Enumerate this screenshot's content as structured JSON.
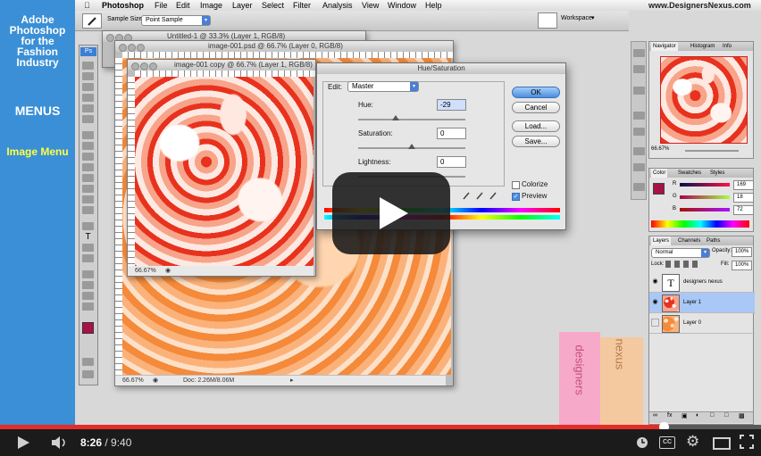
{
  "sidebar": {
    "title": "Adobe Photoshop for the Fashion Industry",
    "section": "MENUS",
    "topic": "Image Menu"
  },
  "menubar": {
    "app": "Photoshop",
    "items": [
      "File",
      "Edit",
      "Image",
      "Layer",
      "Select",
      "Filter",
      "Analysis",
      "View",
      "Window",
      "Help"
    ],
    "brand": "www.DesignersNexus.com"
  },
  "options": {
    "sample_size_label": "Sample Size:",
    "sample_size_value": "Point Sample",
    "workspace": "Workspace"
  },
  "windows": {
    "untitled": {
      "title": "Untitled-1 @ 33.3% (Layer 1, RGB/8)"
    },
    "image001": {
      "title": "image-001.psd @ 66.7% (Layer 0, RGB/8)",
      "zoom": "66.67%",
      "doc": "Doc: 2.26M/8.06M"
    },
    "copy": {
      "title": "image-001 copy @ 66.7% (Layer 1, RGB/8)",
      "zoom": "66.67%"
    }
  },
  "hue_saturation": {
    "title": "Hue/Saturation",
    "edit_label": "Edit:",
    "edit_value": "Master",
    "hue_label": "Hue:",
    "hue_value": "-29",
    "saturation_label": "Saturation:",
    "saturation_value": "0",
    "lightness_label": "Lightness:",
    "lightness_value": "0",
    "buttons": {
      "ok": "OK",
      "cancel": "Cancel",
      "load": "Load...",
      "save": "Save..."
    },
    "colorize_label": "Colorize",
    "colorize_checked": false,
    "preview_label": "Preview",
    "preview_checked": true
  },
  "navigator": {
    "tabs": [
      "Navigator",
      "Histogram",
      "Info"
    ],
    "zoom": "66.67%"
  },
  "color_panel": {
    "tabs": [
      "Color",
      "Swatches",
      "Styles"
    ],
    "r_label": "R",
    "g_label": "G",
    "b_label": "B",
    "r": "169",
    "g": "18",
    "b": "72",
    "foreground": "#a91248"
  },
  "layers_panel": {
    "tabs": [
      "Layers",
      "Channels",
      "Paths"
    ],
    "blend_mode": "Normal",
    "opacity_label": "Opacity:",
    "opacity": "100%",
    "lock_label": "Lock:",
    "fill_label": "Fill:",
    "fill": "100%",
    "layers": [
      {
        "name": "designers nexus",
        "type": "text",
        "visible": true,
        "selected": false
      },
      {
        "name": "Layer 1",
        "type": "image",
        "visible": true,
        "selected": true
      },
      {
        "name": "Layer 0",
        "type": "image",
        "visible": false,
        "selected": false
      }
    ]
  },
  "watermark": {
    "line1": "designers",
    "line2": "nexus"
  },
  "player": {
    "current_time": "8:26",
    "separator": " / ",
    "duration": "9:40",
    "progress_fraction": 0.872,
    "accent": "#e52d27"
  }
}
